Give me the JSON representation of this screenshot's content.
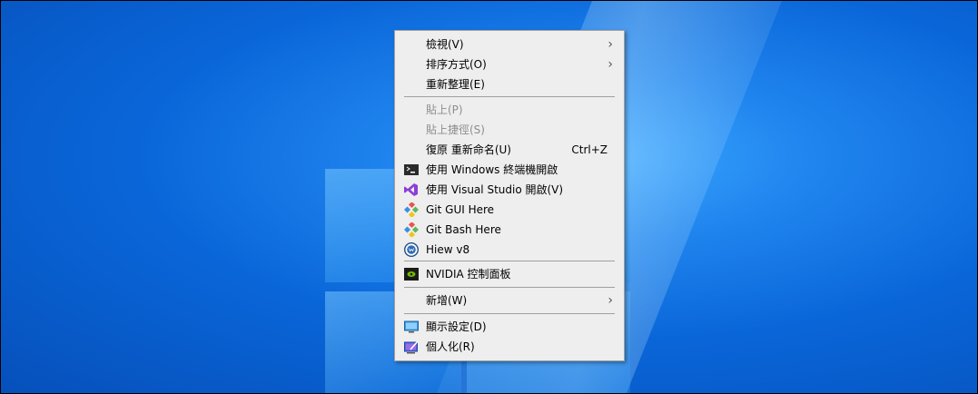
{
  "menu": {
    "items": [
      {
        "label": "檢視(V)",
        "submenu": true
      },
      {
        "label": "排序方式(O)",
        "submenu": true
      },
      {
        "label": "重新整理(E)"
      },
      {
        "label": "貼上(P)",
        "disabled": true
      },
      {
        "label": "貼上捷徑(S)",
        "disabled": true
      },
      {
        "label": "復原 重新命名(U)",
        "shortcut": "Ctrl+Z"
      },
      {
        "label": "使用 Windows 終端機開啟",
        "icon": "terminal-icon"
      },
      {
        "label": "使用 Visual Studio 開啟(V)",
        "icon": "visual-studio-icon"
      },
      {
        "label": "Git GUI Here",
        "icon": "git-icon"
      },
      {
        "label": "Git Bash Here",
        "icon": "git-icon"
      },
      {
        "label": "Hiew v8",
        "icon": "hiew-icon"
      },
      {
        "label": "NVIDIA 控制面板",
        "icon": "nvidia-icon"
      },
      {
        "label": "新增(W)",
        "submenu": true
      },
      {
        "label": "顯示設定(D)",
        "icon": "display-icon"
      },
      {
        "label": "個人化(R)",
        "icon": "personalize-icon"
      }
    ],
    "arrow": "›"
  }
}
